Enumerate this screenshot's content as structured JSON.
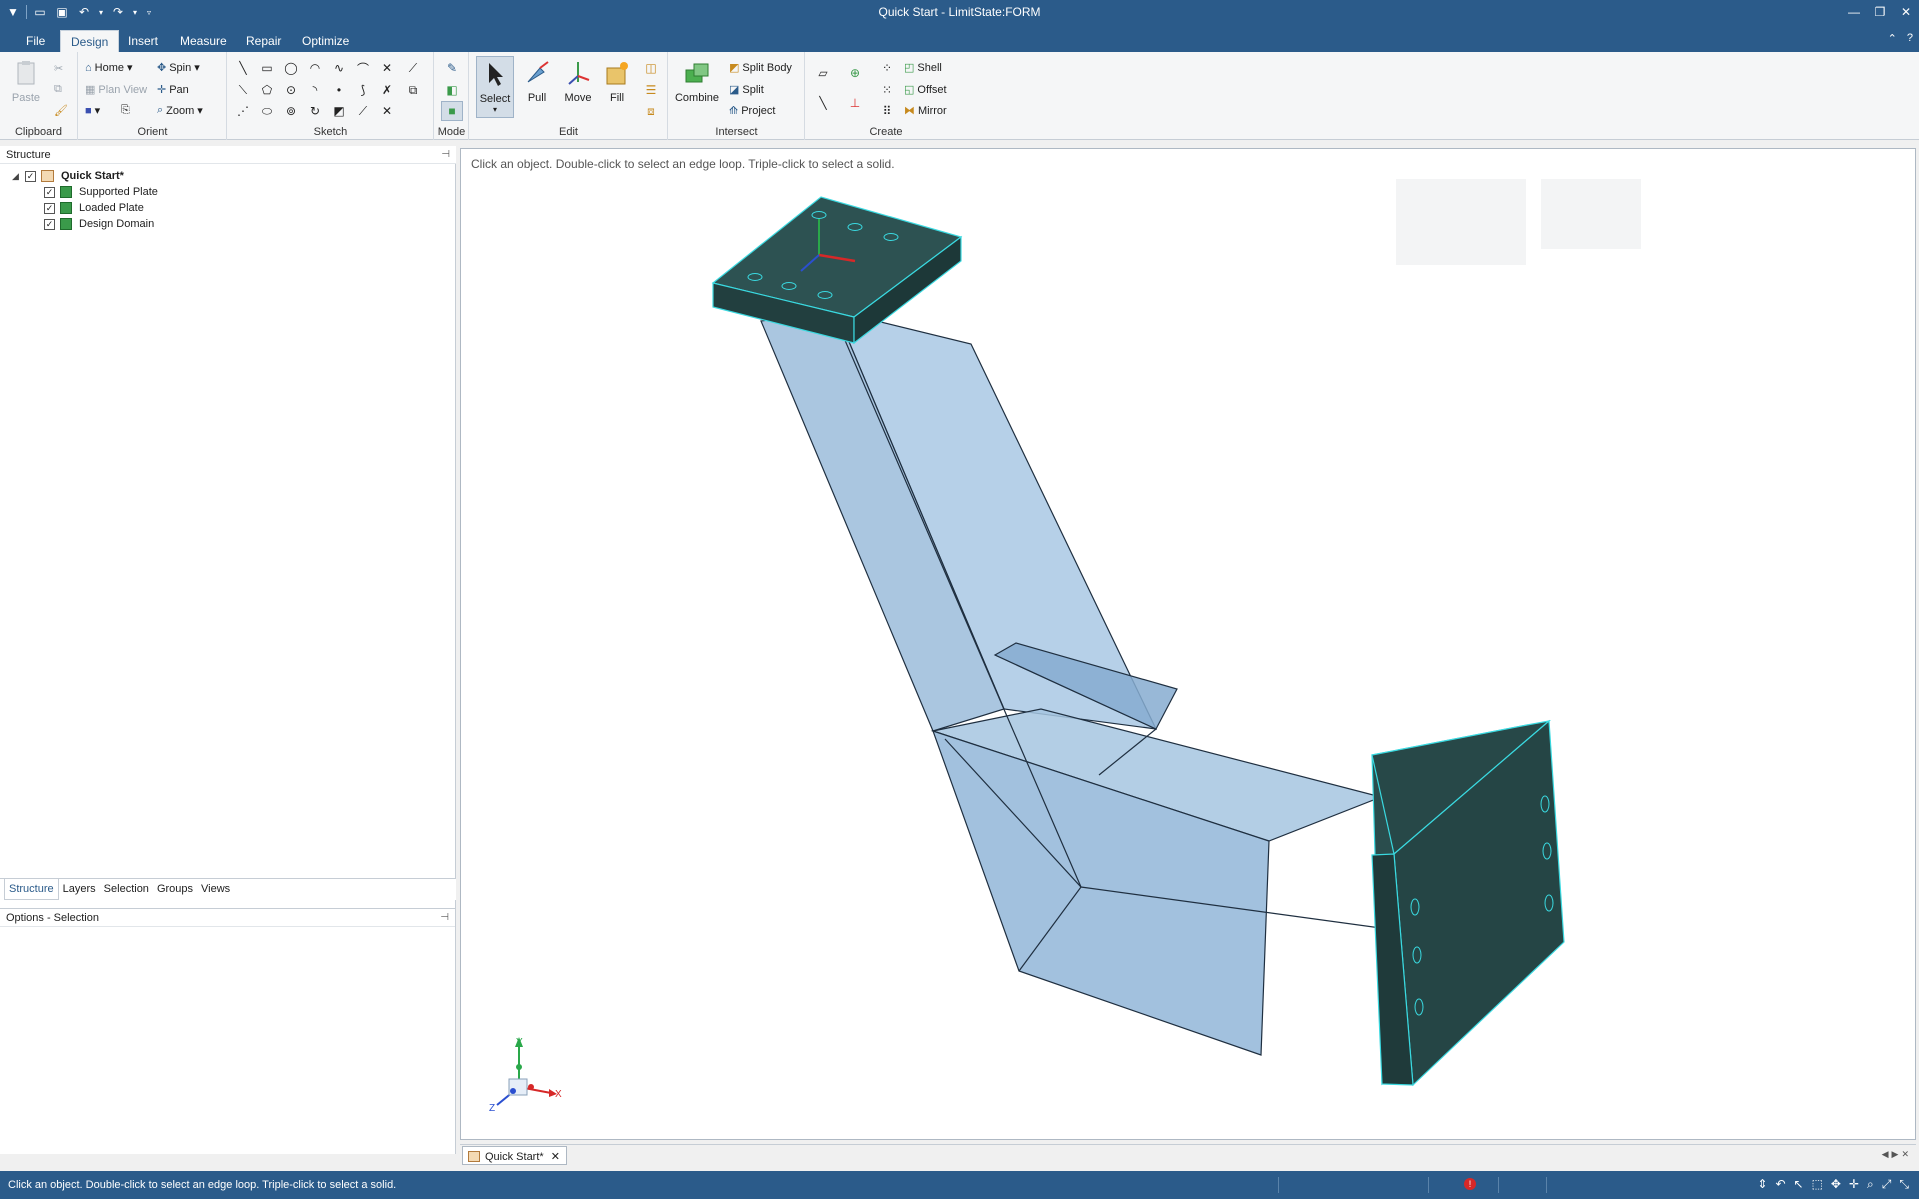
{
  "window": {
    "title": "Quick Start - LimitState:FORM"
  },
  "ribbon_tabs": [
    "File",
    "Design",
    "Insert",
    "Measure",
    "Repair",
    "Optimize"
  ],
  "active_tab": "Design",
  "groups": {
    "clipboard": {
      "label": "Clipboard",
      "paste": "Paste"
    },
    "orient": {
      "label": "Orient",
      "home": "Home",
      "spin": "Spin",
      "plan_view": "Plan View",
      "pan": "Pan",
      "zoom": "Zoom"
    },
    "sketch": {
      "label": "Sketch"
    },
    "mode": {
      "label": "Mode"
    },
    "edit": {
      "label": "Edit",
      "select": "Select",
      "pull": "Pull",
      "move": "Move",
      "fill": "Fill"
    },
    "intersect": {
      "label": "Intersect",
      "combine": "Combine",
      "split_body": "Split Body",
      "split": "Split",
      "project": "Project"
    },
    "create": {
      "label": "Create",
      "shell": "Shell",
      "offset": "Offset",
      "mirror": "Mirror"
    }
  },
  "structure": {
    "header": "Structure",
    "root": "Quick Start*",
    "items": [
      "Supported Plate",
      "Loaded Plate",
      "Design Domain"
    ],
    "tabs": [
      "Structure",
      "Layers",
      "Selection",
      "Groups",
      "Views"
    ],
    "active_tab": "Structure"
  },
  "options": {
    "header": "Options - Selection"
  },
  "viewport": {
    "hint": "Click an object. Double-click to select an edge loop. Triple-click to select a solid.",
    "triad": {
      "x": "X",
      "y": "Y",
      "z": "Z"
    }
  },
  "doc_tab": {
    "label": "Quick Start*"
  },
  "status": {
    "text": "Click an object. Double-click to select an edge loop. Triple-click to select a solid."
  },
  "colors": {
    "titlebar": "#2b5b8a",
    "plate": "#274848",
    "plate_edge": "#3ad9e0",
    "domain": "#9fc0df",
    "domain_edge": "#1f2f40"
  }
}
